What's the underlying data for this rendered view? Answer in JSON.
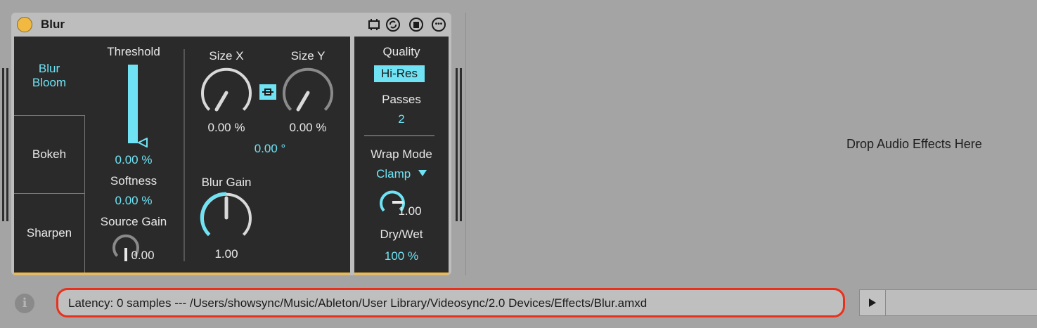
{
  "device": {
    "title": "Blur",
    "toolbar_icons": [
      "cpu-icon",
      "hot-swap-icon",
      "save-icon",
      "more-icon"
    ]
  },
  "modes": {
    "selected_line1": "Blur",
    "selected_line2": "Bloom",
    "bokeh": "Bokeh",
    "sharpen": "Sharpen"
  },
  "threshold": {
    "label": "Threshold",
    "value": "0.00 %",
    "level": 0.0
  },
  "softness": {
    "label": "Softness",
    "value": "0.00 %"
  },
  "source_gain": {
    "label": "Source Gain",
    "value": "0.00"
  },
  "size_x": {
    "label": "Size X",
    "value": "0.00 %"
  },
  "size_y": {
    "label": "Size Y",
    "value": "0.00 %"
  },
  "angle": {
    "value": "0.00 °"
  },
  "blur_gain": {
    "label": "Blur Gain",
    "value": "1.00"
  },
  "quality": {
    "label": "Quality",
    "value": "Hi-Res"
  },
  "passes": {
    "label": "Passes",
    "value": "2"
  },
  "wrap_mode": {
    "label": "Wrap Mode",
    "value": "Clamp"
  },
  "wrap_knob": {
    "value": "1.00"
  },
  "dry_wet": {
    "label": "Dry/Wet",
    "value": "100 %"
  },
  "drop_zone": {
    "text": "Drop Audio Effects Here"
  },
  "status_bar": {
    "text": "Latency: 0 samples --- /Users/showsync/Music/Ableton/User Library/Videosync/2.0 Devices/Effects/Blur.amxd"
  },
  "colors": {
    "accent": "#6fe3f4",
    "panel": "#2a2a2a",
    "power": "#f2b942",
    "highlight": "#e8311c"
  }
}
